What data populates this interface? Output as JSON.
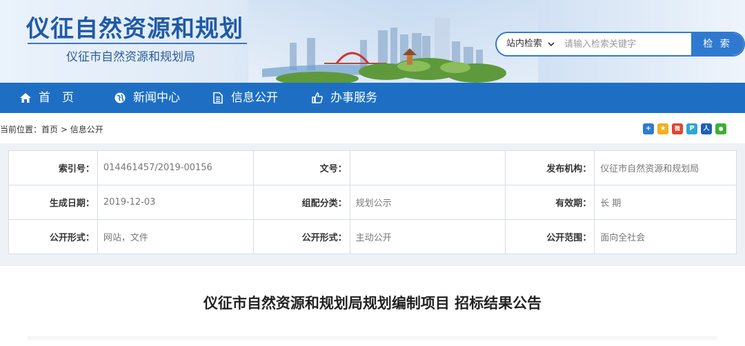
{
  "header": {
    "title": "仪征自然资源和规划",
    "subtitle": "仪征市自然资源和规划局"
  },
  "search": {
    "scope": "站内检索",
    "placeholder": "请输入检索关键字",
    "button": "检 索"
  },
  "nav": {
    "items": [
      {
        "label": "首　页",
        "icon": "home-icon"
      },
      {
        "label": "新闻中心",
        "icon": "globe-icon"
      },
      {
        "label": "信息公开",
        "icon": "document-icon"
      },
      {
        "label": "办事服务",
        "icon": "thumbs-up-icon"
      }
    ]
  },
  "breadcrumb": {
    "prefix": "当前位置：",
    "home": "首页",
    "separator": " > ",
    "current": "信息公开"
  },
  "share": {
    "icons": [
      {
        "name": "share-more-icon",
        "color": "#2f7ad0",
        "glyph": "+"
      },
      {
        "name": "qzone-icon",
        "color": "#f2b01e",
        "glyph": "★"
      },
      {
        "name": "weibo-icon",
        "color": "#e0452f",
        "glyph": "微"
      },
      {
        "name": "tencent-weibo-icon",
        "color": "#2fa6d6",
        "glyph": "P"
      },
      {
        "name": "renren-icon",
        "color": "#1d5fb7",
        "glyph": "人"
      },
      {
        "name": "wechat-icon",
        "color": "#3cb034",
        "glyph": "●"
      }
    ]
  },
  "meta": {
    "rows": [
      [
        {
          "label": "索引号：",
          "value": "014461457/2019-00156"
        },
        {
          "label": "文号：",
          "value": ""
        },
        {
          "label": "发布机构：",
          "value": "仪征市自然资源和规划局"
        }
      ],
      [
        {
          "label": "生成日期：",
          "value": "2019-12-03"
        },
        {
          "label": "组配分类：",
          "value": "规划公示"
        },
        {
          "label": "有效期：",
          "value": "长 期"
        }
      ],
      [
        {
          "label": "公开形式：",
          "value": "网站，文件"
        },
        {
          "label": "公开形式：",
          "value": "主动公开"
        },
        {
          "label": "公开范围：",
          "value": "面向全社会"
        }
      ]
    ]
  },
  "article": {
    "title": "仪征市自然资源和规划局规划编制项目 招标结果公告"
  },
  "colors": {
    "brand": "#1e6fc4",
    "title": "#1f5aa8"
  }
}
